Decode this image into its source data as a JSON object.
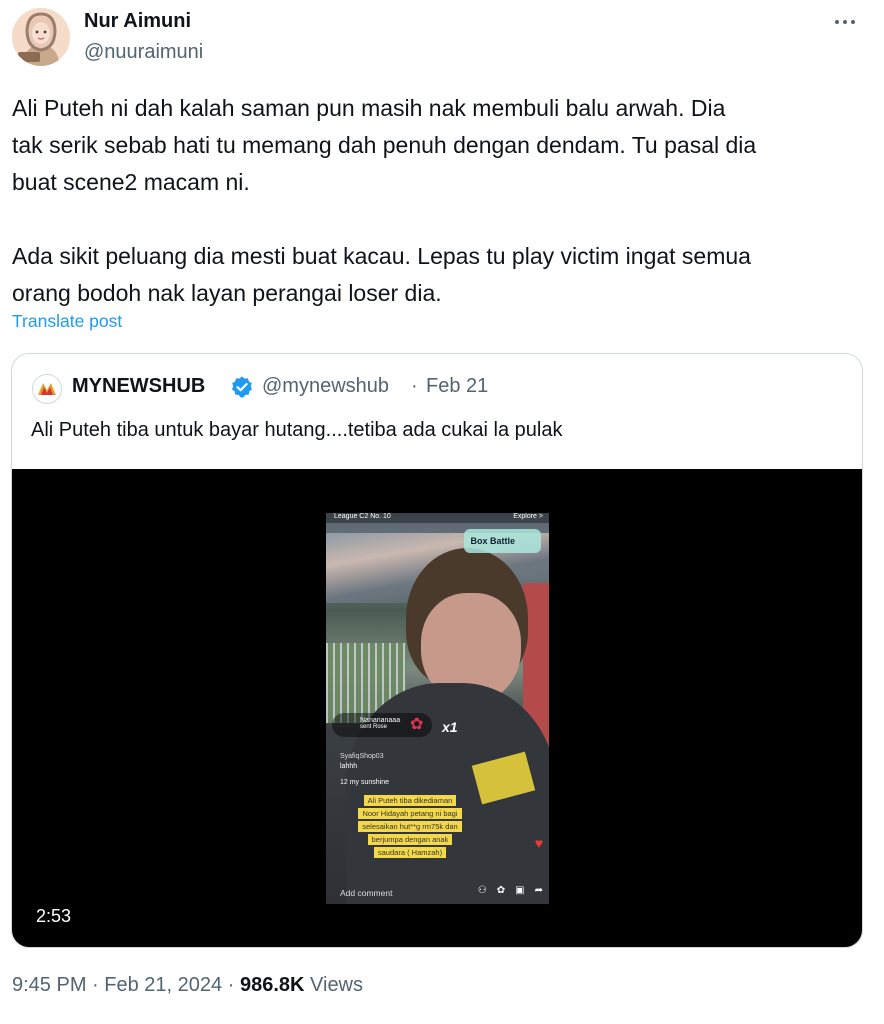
{
  "tweet": {
    "author_name": "Nur Aimuni",
    "author_handle": "@nuuraimuni",
    "text": "Ali Puteh ni dah kalah saman pun masih nak membuli balu arwah. Dia\ntak serik sebab hati tu memang dah penuh dengan dendam. Tu pasal dia\nbuat scene2 macam ni.\n\nAda sikit peluang dia mesti buat kacau. Lepas tu play victim ingat semua\norang bodoh nak layan perangai loser dia.",
    "translate_label": "Translate post",
    "time": "9:45 PM",
    "sep1": "·",
    "date": "Feb 21, 2024",
    "sep2": "·",
    "views_count": "986.8K",
    "views_label": "Views"
  },
  "quote": {
    "name": "MYNEWSHUB",
    "handle": "@mynewshub",
    "dot": "·",
    "date": "Feb 21",
    "text": "Ali Puteh tiba untuk bayar hutang....tetiba ada cukai la pulak",
    "video": {
      "duration": "2:53",
      "overlay": {
        "league": "League C2 No. 10",
        "explore": "Explore >",
        "box_battle": "Box Battle",
        "gift_user": "Nanananaaa",
        "gift_sub": "sent Rose",
        "gift_count": "x1",
        "chat_user": "SyafiqShop03",
        "chat_msg": "lahhh",
        "chat_join": "12 my sunshine",
        "caption_lines": [
          "Ali Puteh tiba dikediaman",
          "Noor Hidayah petang ni bagi",
          "selesaikan hut**g rm75k dan",
          "berjumpa dengan anak",
          "saudara ( Hamzah)"
        ],
        "add_comment": "Add comment"
      }
    }
  },
  "colors": {
    "text_primary": "#0f1419",
    "text_secondary": "#536471",
    "link": "#1d9bf0",
    "border": "#cfd9de",
    "verified": "#1d9bf0"
  },
  "icons": {
    "more": "more-horizontal-icon",
    "verified": "verified-badge-icon",
    "logo": "mynewshub-logo"
  }
}
